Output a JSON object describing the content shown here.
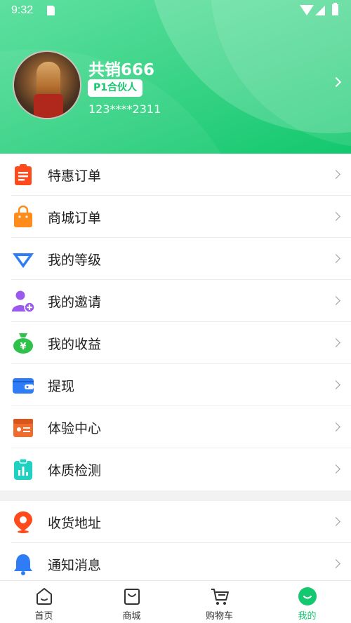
{
  "status_bar": {
    "time": "9:32"
  },
  "profile": {
    "name": "共销666",
    "level_badge": "P1合伙人",
    "phone": "123****2311"
  },
  "menu_group_1": [
    {
      "label": "特惠订单",
      "icon": "clipboard-icon",
      "color": "#ff4a1c"
    },
    {
      "label": "商城订单",
      "icon": "shopping-bag-icon",
      "color": "#ff8c1a"
    },
    {
      "label": "我的等级",
      "icon": "diamond-icon",
      "color": "#2f7df6"
    },
    {
      "label": "我的邀请",
      "icon": "add-user-icon",
      "color": "#9b59f0"
    },
    {
      "label": "我的收益",
      "icon": "money-bag-icon",
      "color": "#2ec24a"
    },
    {
      "label": "提现",
      "icon": "wallet-icon",
      "color": "#2f7df6"
    },
    {
      "label": "体验中心",
      "icon": "experience-box-icon",
      "color": "#f06b2c"
    },
    {
      "label": "体质检测",
      "icon": "health-report-icon",
      "color": "#1fd1c1"
    }
  ],
  "menu_group_2": [
    {
      "label": "收货地址",
      "icon": "location-pin-icon",
      "color": "#ff4a1c"
    },
    {
      "label": "通知消息",
      "icon": "bell-icon",
      "color": "#2f7df6"
    }
  ],
  "bottom_nav": [
    {
      "label": "首页",
      "icon": "home-icon",
      "active": false
    },
    {
      "label": "商城",
      "icon": "bag-icon",
      "active": false
    },
    {
      "label": "购物车",
      "icon": "cart-icon",
      "active": false
    },
    {
      "label": "我的",
      "icon": "profile-smile-icon",
      "active": true
    }
  ],
  "colors": {
    "brand_green": "#13c86e",
    "accent_text": "#17c56f"
  }
}
